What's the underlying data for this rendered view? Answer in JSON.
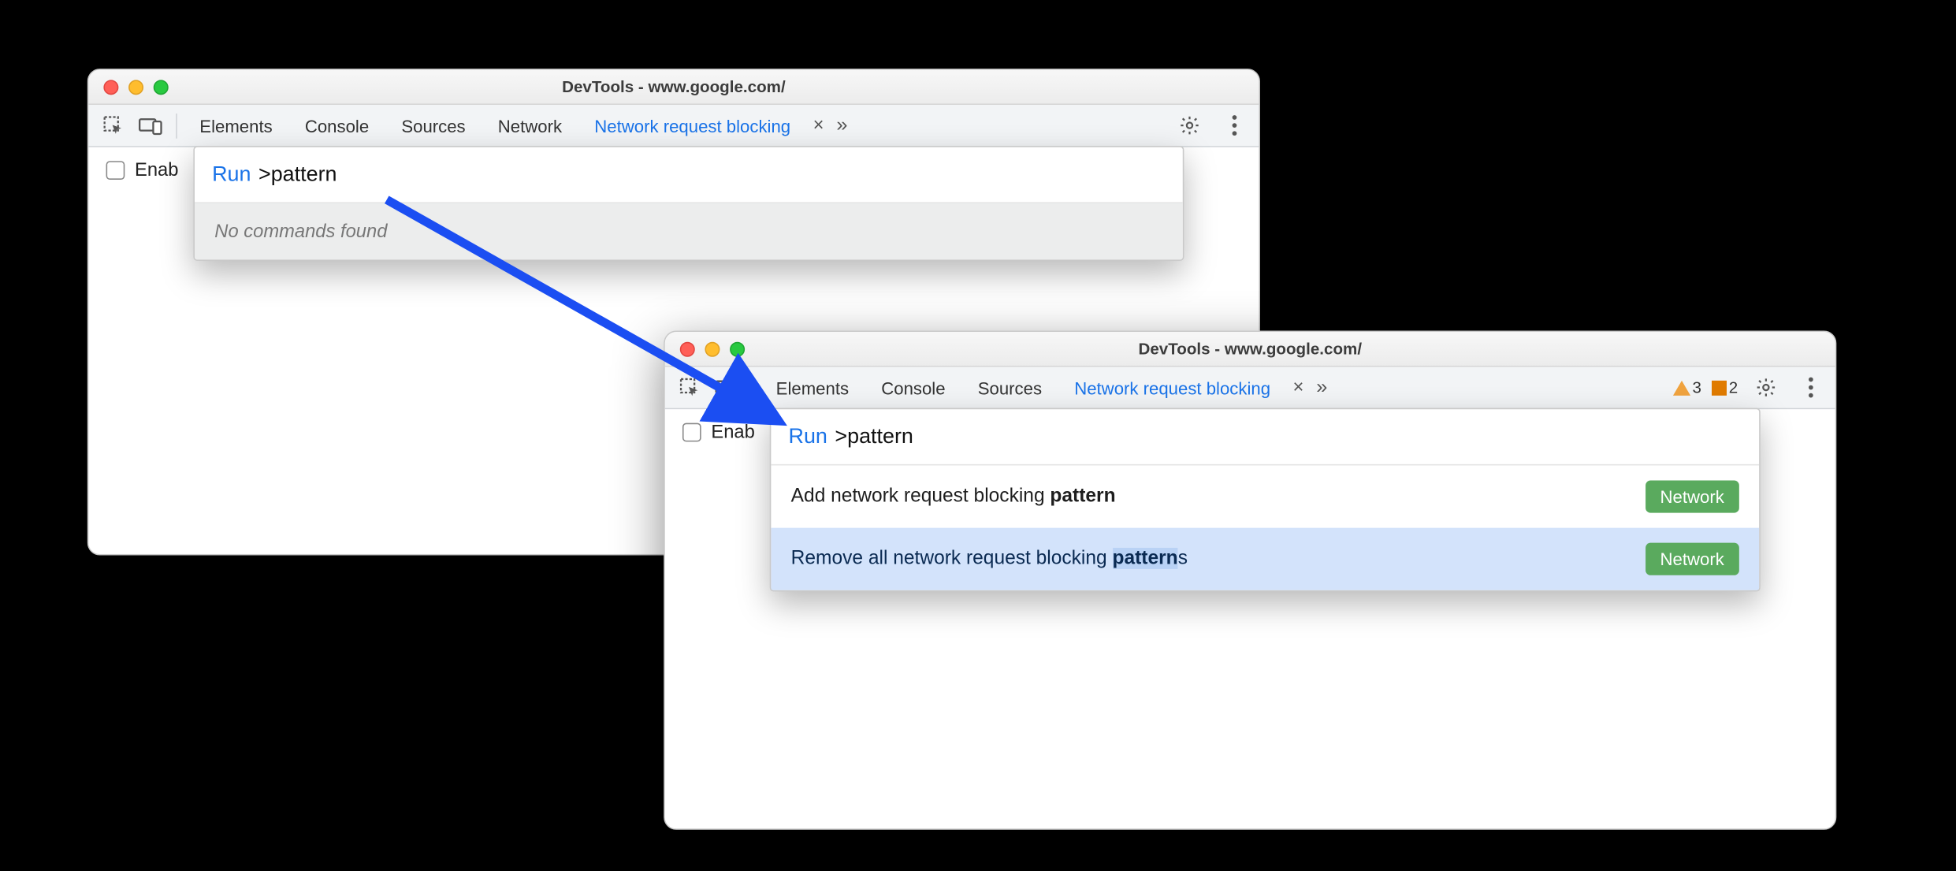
{
  "windowA": {
    "title": "DevTools - www.google.com/",
    "tabs": {
      "elements": "Elements",
      "console": "Console",
      "sources": "Sources",
      "network": "Network",
      "active": "Network request blocking"
    },
    "enable_label": "Enab",
    "cmd": {
      "run_label": "Run",
      "query": ">pattern",
      "empty": "No commands found"
    }
  },
  "windowB": {
    "title": "DevTools - www.google.com/",
    "tabs": {
      "elements": "Elements",
      "console": "Console",
      "sources": "Sources",
      "active": "Network request blocking"
    },
    "badges": {
      "warn": "3",
      "issue": "2"
    },
    "enable_label": "Enab",
    "cmd": {
      "run_label": "Run",
      "query": ">pattern",
      "items": [
        {
          "prefix": "Add network request blocking ",
          "match": "pattern",
          "suffix": "",
          "badge": "Network"
        },
        {
          "prefix": "Remove all network request blocking ",
          "match": "pattern",
          "suffix": "s",
          "badge": "Network"
        }
      ]
    }
  }
}
